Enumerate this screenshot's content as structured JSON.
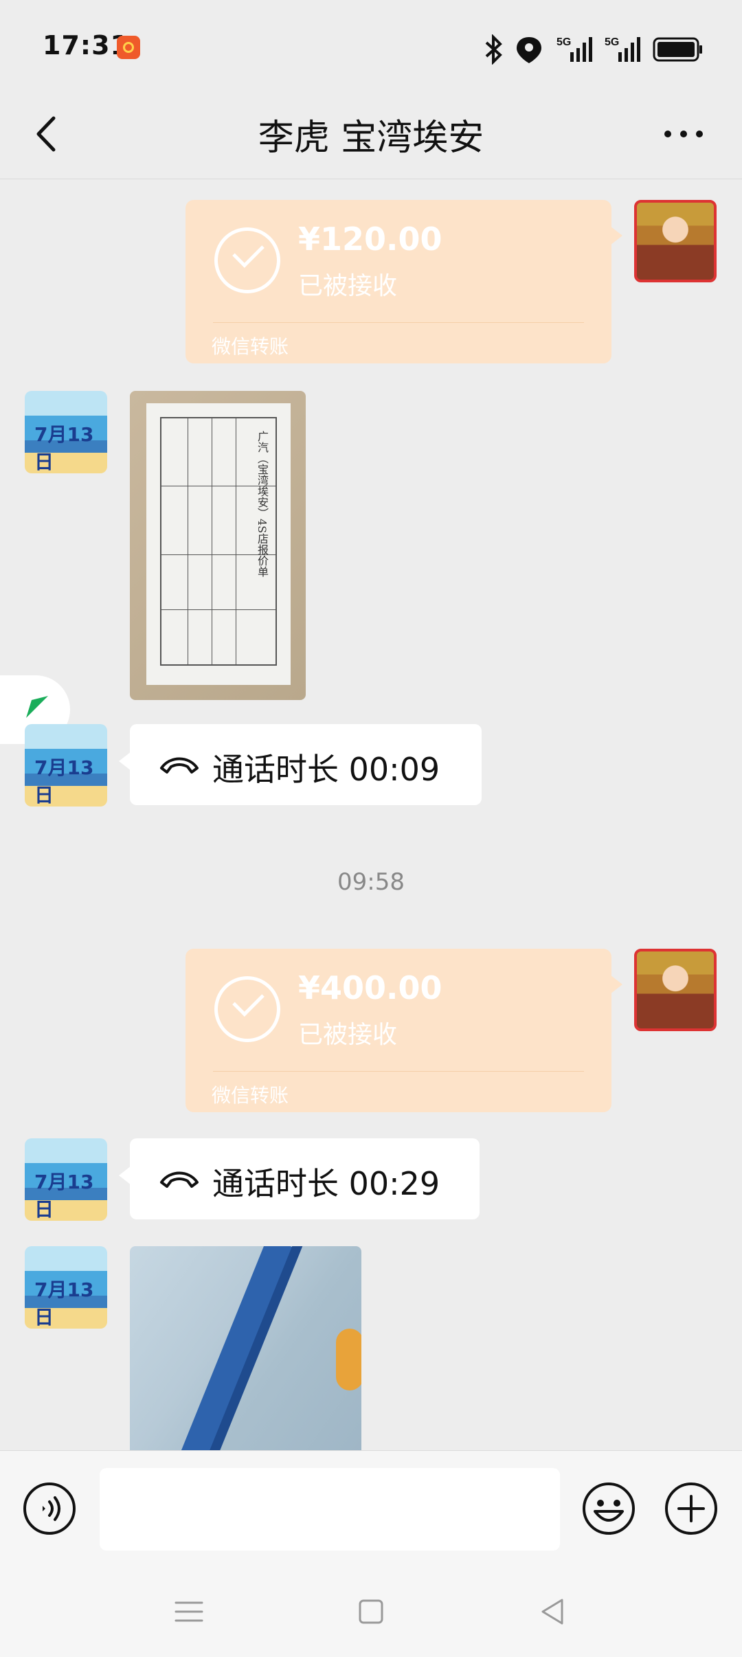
{
  "status_bar": {
    "time": "17:31",
    "network_label_1": "5G",
    "network_label_2": "5G",
    "icons": [
      "app-notification-icon",
      "bluetooth-icon",
      "location-icon",
      "signal-5g-icon",
      "signal-5g-icon",
      "battery-icon"
    ]
  },
  "header": {
    "title": "李虎  宝湾埃安",
    "back_icon": "chevron-left-icon",
    "more_icon": "more-dots-icon"
  },
  "messages": [
    {
      "type": "transfer",
      "side": "self",
      "amount": "¥120.00",
      "status": "已被接收",
      "label": "微信转账"
    },
    {
      "type": "image",
      "side": "friend",
      "description_icon": "quote-sheet-photo"
    },
    {
      "type": "call",
      "side": "friend",
      "text": "通话时长 00:09"
    },
    {
      "type": "timestamp",
      "text": "09:58"
    },
    {
      "type": "transfer",
      "side": "self",
      "amount": "¥400.00",
      "status": "已被接收",
      "label": "微信转账"
    },
    {
      "type": "call",
      "side": "friend",
      "text": "通话时长 00:29"
    },
    {
      "type": "image",
      "side": "friend",
      "description_icon": "car-interior-photo"
    }
  ],
  "doc_photo": {
    "title": "广汽（宝湾埃安）4S店报价单"
  },
  "avatar_friend_text": "7月13日",
  "input": {
    "value": "",
    "placeholder": ""
  },
  "colors": {
    "background": "#ededed",
    "transfer_bubble": "#fde3c9",
    "bubble_white": "#ffffff"
  }
}
